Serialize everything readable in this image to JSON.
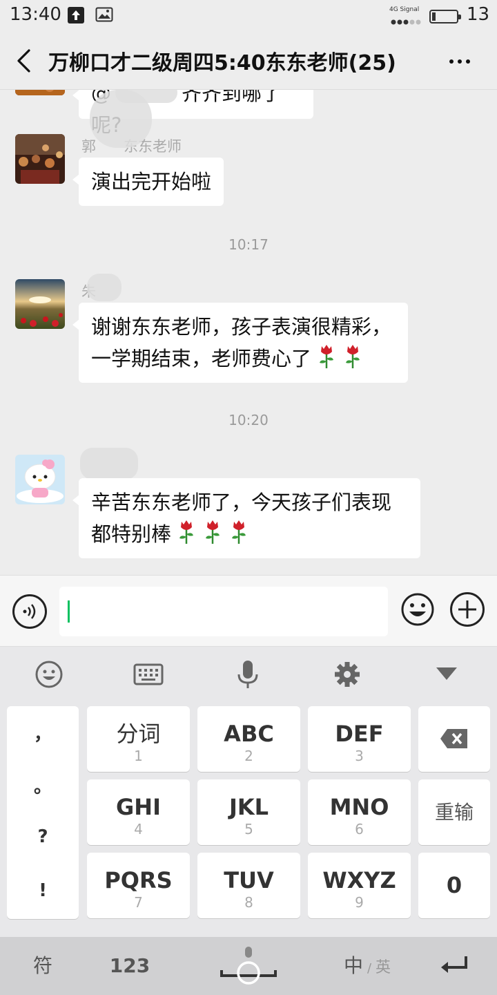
{
  "status_bar": {
    "time": "13:40",
    "network_label": "4G Signal",
    "battery_level": "13"
  },
  "header": {
    "title": "万柳口才二级周四5:40东东老师(25)",
    "back_icon": "chevron-left-icon",
    "more_icon": "more-icon"
  },
  "messages": [
    {
      "type": "text",
      "sender": "",
      "text_a": "@",
      "text_b": "齐齐到哪了呢?"
    },
    {
      "type": "text",
      "sender": "郭",
      "sender_suffix": "东东老师",
      "text": "演出完开始啦"
    },
    {
      "type": "timestamp",
      "text": "10:17"
    },
    {
      "type": "text",
      "sender": "朱",
      "line1": "谢谢东东老师，孩子表演很精彩，",
      "line2": "一学期结束，老师费心了",
      "rose_count": 2
    },
    {
      "type": "timestamp",
      "text": "10:20"
    },
    {
      "type": "text",
      "sender": "",
      "line1": "辛苦东东老师了，今天孩子们表现",
      "line2": "都特别棒",
      "rose_count": 3
    }
  ],
  "input": {
    "value": ""
  },
  "keyboard": {
    "tools": [
      "emoji-icon",
      "keyboard-icon",
      "microphone-icon",
      "gear-icon",
      "collapse-icon"
    ],
    "punct": [
      "，",
      "。",
      "?",
      "!"
    ],
    "keys": [
      {
        "main": "分词",
        "sub": "1"
      },
      {
        "main": "ABC",
        "sub": "2"
      },
      {
        "main": "DEF",
        "sub": "3"
      },
      {
        "main": "GHI",
        "sub": "4"
      },
      {
        "main": "JKL",
        "sub": "5"
      },
      {
        "main": "MNO",
        "sub": "6"
      },
      {
        "main": "PQRS",
        "sub": "7"
      },
      {
        "main": "TUV",
        "sub": "8"
      },
      {
        "main": "WXYZ",
        "sub": "9"
      }
    ],
    "retype": "重输",
    "zero": "0",
    "symbol": "符",
    "num": "123",
    "lang_main": "中",
    "lang_sep": "/",
    "lang_alt": "英"
  },
  "colors": {
    "background": "#ededed",
    "bubble": "#ffffff",
    "cursor": "#07c160",
    "rose": "#d0202a"
  }
}
